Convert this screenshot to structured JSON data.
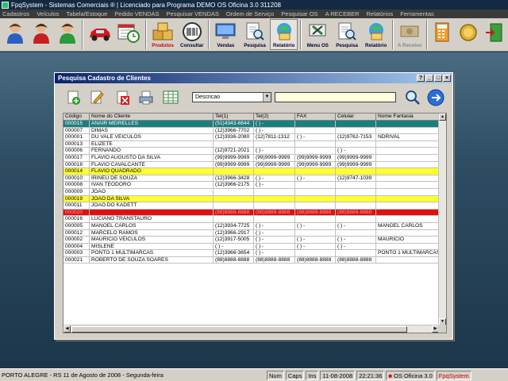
{
  "window": {
    "title": "FpqSystem - Sistemas Comerciais ® | Licenciado para Programa DEMO OS Oficina 3.0 311208"
  },
  "menu": [
    "Cadastros",
    "Veículos",
    "Tabela/Estoque",
    "Pedido VENDAS",
    "Pesquisar VENDAS",
    "Ordem de Serviço",
    "Pesquisar OS",
    "A RECEBER",
    "Relatórios",
    "Ferramentas"
  ],
  "toolbar": {
    "produtos": "Produtos",
    "consultar": "Consultar",
    "vendas": "Vendas",
    "pesquisa1": "Pesquisa",
    "relatorio1": "Relatório",
    "menu_os": "Menu OS",
    "pesquisa2": "Pesquisa",
    "relatorio2": "Relatório",
    "a_receber": "A Receber"
  },
  "dialog": {
    "title": "Pesquisa Cadastro de Clientes",
    "title_buttons": [
      "?",
      "_",
      "□",
      "×"
    ],
    "search_field": "Descricao",
    "search_text": ""
  },
  "grid": {
    "columns": [
      "Código",
      "Nome do Cliente",
      "Tel(1)",
      "Tel(2)",
      "FAX",
      "Celular",
      "Nome Fantasia"
    ],
    "rows": [
      {
        "c": [
          "000015",
          "ANAIR MEIRELLES",
          "(51)4343-6644",
          "( )  -",
          "",
          "",
          ""
        ],
        "style": "selected"
      },
      {
        "c": [
          "000007",
          "DIMAS",
          "(12)3966-7702",
          "( )  -",
          "",
          "",
          ""
        ],
        "style": ""
      },
      {
        "c": [
          "000001",
          "DU VALE VEICULOS",
          "(12)3936-2080",
          "(12)7811-1312",
          "( )  -",
          "(12)9762-7153",
          "NDRIVAL"
        ],
        "style": ""
      },
      {
        "c": [
          "000013",
          "ELIZETE",
          "",
          "",
          "",
          "",
          ""
        ],
        "style": ""
      },
      {
        "c": [
          "000006",
          "FERNANDO",
          "(12)9721-2021",
          "( )  -",
          "",
          "( )  -",
          ""
        ],
        "style": ""
      },
      {
        "c": [
          "000017",
          "FLAVIO AUGUSTO DA SILVA",
          "(99)9999-9999",
          "(99)9999-9999",
          "(99)9999-9999",
          "(99)9999-9999",
          ""
        ],
        "style": ""
      },
      {
        "c": [
          "000018",
          "FLAVIO CAVALCANTE",
          "(99)9999-9999",
          "(99)9999-9999",
          "(99)9999-9999",
          "(99)9999-9999",
          ""
        ],
        "style": ""
      },
      {
        "c": [
          "000014",
          "FLAVIO QUADRADO",
          "",
          "",
          "",
          "",
          ""
        ],
        "style": "yellow"
      },
      {
        "c": [
          "000010",
          "IRINEU DE SOUZA",
          "(12)3966-3428",
          "( )  -",
          "( )  -",
          "(12)9747-1039",
          ""
        ],
        "style": ""
      },
      {
        "c": [
          "000008",
          "IVAN TEODORO",
          "(12)3966-2175",
          "( )  -",
          "",
          "",
          ""
        ],
        "style": ""
      },
      {
        "c": [
          "000009",
          "JOÃO",
          "",
          "",
          "",
          "",
          ""
        ],
        "style": ""
      },
      {
        "c": [
          "000019",
          "JOÃO DA SILVA",
          "",
          "",
          "",
          "",
          ""
        ],
        "style": "yellow"
      },
      {
        "c": [
          "000011",
          "JOÃO DO KADETT",
          "",
          "",
          "",
          "",
          ""
        ],
        "style": ""
      },
      {
        "c": [
          "000020",
          "",
          "(88)8888-8888",
          "(88)8888-8888",
          "(88)8888-8888",
          "(88)8888-8888",
          ""
        ],
        "style": "red"
      },
      {
        "c": [
          "000016",
          "LUCIANO TRANSTAURO",
          "",
          "",
          "",
          "",
          ""
        ],
        "style": ""
      },
      {
        "c": [
          "000005",
          "MANOEL CARLOS",
          "(12)3934-7725",
          "( )  -",
          "( )  -",
          "( )  -",
          "MANOEL CARLOS"
        ],
        "style": ""
      },
      {
        "c": [
          "000012",
          "MARCELO RAMOS",
          "(12)3966-2917",
          "( )  -",
          "",
          "",
          ""
        ],
        "style": ""
      },
      {
        "c": [
          "000002",
          "MAURICIO VEICULOS",
          "(12)3917-5005",
          "( )  -",
          "( )  -",
          "( )  -",
          "MAURICIO"
        ],
        "style": ""
      },
      {
        "c": [
          "000004",
          "MISLENE",
          "( )  -",
          "( )  -",
          "( )  -",
          "( )  -",
          ""
        ],
        "style": ""
      },
      {
        "c": [
          "000003",
          "PONTO 1 MULTIMARCAS",
          "(12)3966-3654",
          "( )  -",
          "",
          "",
          "PONTO 1 MULTIMARCAS"
        ],
        "style": ""
      },
      {
        "c": [
          "000021",
          "ROBERTO DE SOUZA SOARES",
          "(88)8888-8888",
          "(88)8888-8888",
          "(88)8888-8888",
          "(88)8888-8888",
          ""
        ],
        "style": ""
      }
    ]
  },
  "statusbar": {
    "location": "PORTO ALEGRE - RS 11 de Agosto de 2008 - Segunda-feira",
    "num": "Num",
    "caps": "Caps",
    "ins": "Ins",
    "date": "11-08-2008",
    "time": "22:21:36",
    "system": "OS Oficina 3.0",
    "brand": "FpqSystem"
  },
  "colors": {
    "selected": "#1b7f7e",
    "yellow": "#ffff33",
    "red": "#e01010",
    "dialog_title": "#0a246a"
  }
}
